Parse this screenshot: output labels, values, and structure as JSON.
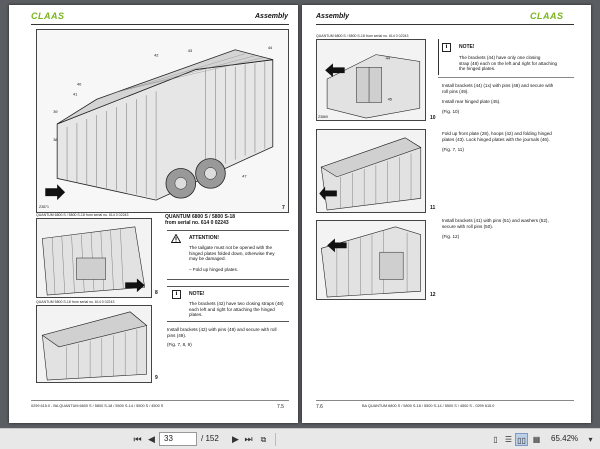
{
  "left_page": {
    "brand": "CLAAS",
    "section": "Assembly",
    "fig7": {
      "number": "7",
      "code": "Z3871"
    },
    "model_title": "QUANTUM 6800 S / 5800 S-18",
    "model_serial": "from serial no. 614 0 02243",
    "fig8": {
      "number": "8",
      "caption": "QUANTUM 6800 S / 5800 S-18 from serial no. 614 0 02243"
    },
    "fig9": {
      "number": "9",
      "caption": "QUANTUM 5800 S-18 from serial no. 614 0 02243"
    },
    "attention": {
      "heading": "ATTENTION!",
      "lines": [
        "The tailgate must not be opened with the",
        "hinged plates folded down, otherwise they",
        "may be damaged."
      ],
      "bullet": "–  Fold up hinged plates."
    },
    "note": {
      "heading": "NOTE!",
      "lines": [
        "The brackets (42) have two closing straps (48)",
        "each left and right for attaching the hinged",
        "plates."
      ]
    },
    "instruction": [
      "Install brackets (42) with pins (48) and secure with roll",
      "pins (49)."
    ],
    "fig_ref": "(Fig. 7, 8, 9)",
    "footer_doc": "0299 615.0 - BA QUANTUM 6800 S / 5800 S-18 / 5500 S-14 / 5500 S / 4500 S",
    "footer_page": "7.5",
    "callouts": [
      "40",
      "41",
      "42",
      "43",
      "44",
      "39",
      "38",
      "47"
    ]
  },
  "right_page": {
    "brand": "CLAAS",
    "section": "Assembly",
    "fig10": {
      "number": "10",
      "caption": "QUANTUM 6800 S / 5800 S-18 from serial no. 614 0 02243",
      "code": "Z3869"
    },
    "fig11": {
      "number": "11"
    },
    "fig12": {
      "number": "12"
    },
    "note": {
      "heading": "NOTE!",
      "lines": [
        "The brackets (44) have only one closing",
        "strap (48) each on the left and right for attaching",
        "the hinged plates."
      ]
    },
    "instr10": [
      "Install brackets (44) (1x) with pins (48) and secure with",
      "roll pins (49).",
      "",
      "Install rear hinged plate (45).",
      "",
      "(Fig. 10)"
    ],
    "instr11": [
      "Fold up front plate (28), hoops (42) and folding hinged",
      "plates (43). Lock hinged plates with the journals (46).",
      "",
      "(Fig. 7, 11)"
    ],
    "instr12": [
      "Install brackets (41) with pins (51) and washers (52),",
      "secure with roll pins (50).",
      "",
      "(Fig. 12)"
    ],
    "footer_page": "7.6",
    "footer_doc": "BA QUANTUM 6800 S / 5800 S-18 / 5500 S-14 / 5500 S / 4500 S - 0299 615.0"
  },
  "toolbar": {
    "current_page": "33",
    "total_pages": "/ 152",
    "zoom": "65.42%"
  }
}
